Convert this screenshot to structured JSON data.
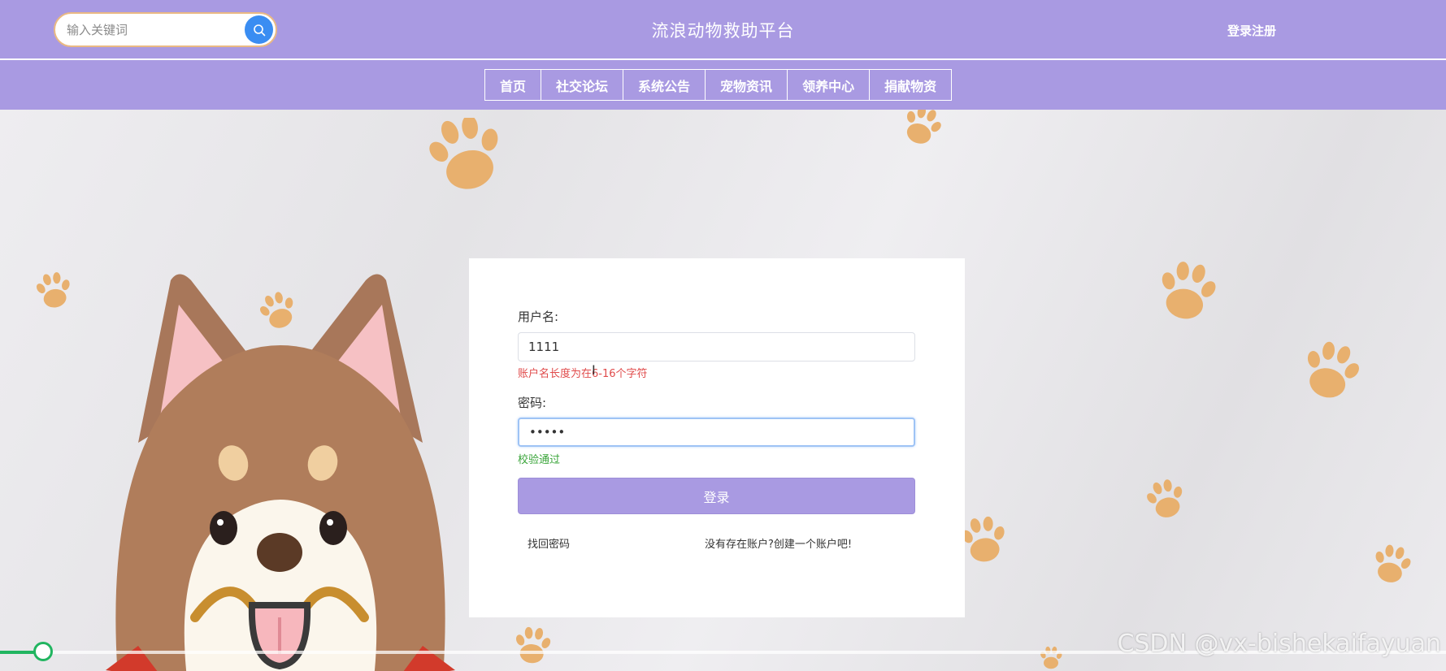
{
  "header": {
    "search_placeholder": "输入关键词",
    "site_title": "流浪动物救助平台",
    "login_register": "登录注册"
  },
  "nav": {
    "items": [
      "首页",
      "社交论坛",
      "系统公告",
      "宠物资讯",
      "领养中心",
      "捐献物资"
    ]
  },
  "login_form": {
    "username_label": "用户名:",
    "username_value": "1111",
    "username_error": "账户名长度为在6-16个字符",
    "password_label": "密码:",
    "password_value": "•••••",
    "password_status": "校验通过",
    "submit_label": "登录",
    "forgot_password": "找回密码",
    "register_prompt": "没有存在账户?创建一个账户吧!"
  },
  "video": {
    "progress": 0.03
  },
  "watermark": "CSDN @vx-bishekaifayuan",
  "colors": {
    "header_bg": "#a99ae2",
    "search_button": "#3a8df2",
    "error": "#e04b4b",
    "success": "#3aa53a",
    "progress": "#21b560"
  },
  "icons": {
    "search": "search-icon",
    "paw": "paw-print-icon",
    "dog": "shiba-dog-illustration"
  }
}
